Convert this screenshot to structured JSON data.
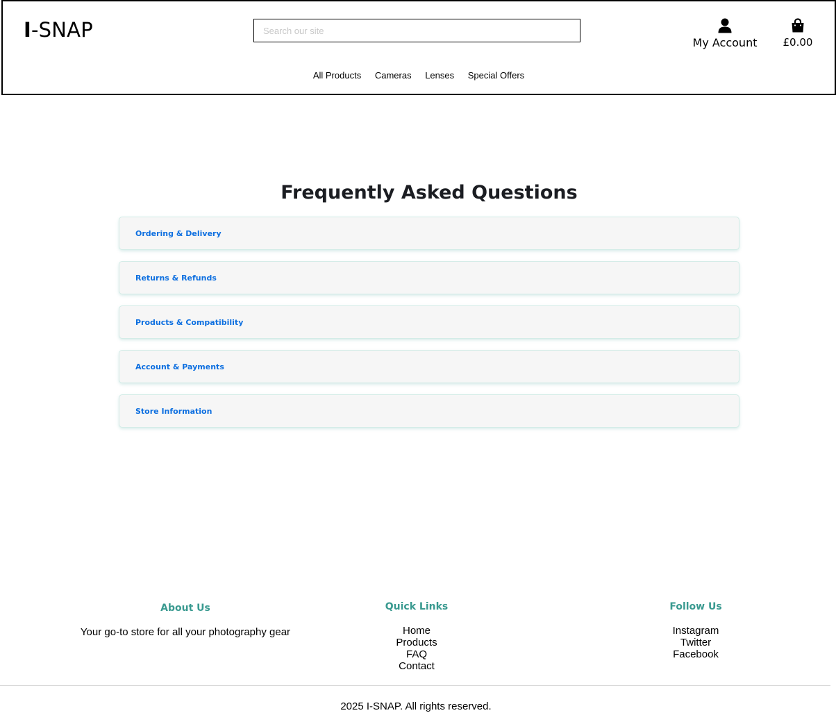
{
  "header": {
    "logo_bar": "I",
    "logo_text": "-SNAP",
    "search_placeholder": "Search our site",
    "account_label": "My Account",
    "cart_total": "£0.00",
    "account_icon": "user-icon",
    "cart_icon": "shopping-bag-icon"
  },
  "nav": {
    "items": [
      "All Products",
      "Cameras",
      "Lenses",
      "Special Offers"
    ]
  },
  "faq": {
    "title": "Frequently Asked Questions",
    "sections": [
      "Ordering & Delivery",
      "Returns & Refunds",
      "Products & Compatibility",
      "Account & Payments",
      "Store Information"
    ]
  },
  "footer": {
    "about": {
      "heading": "About Us",
      "text": "Your go-to store for all your photography gear"
    },
    "quick_links": {
      "heading": "Quick Links",
      "links": [
        "Home",
        "Products",
        "FAQ",
        "Contact"
      ]
    },
    "follow": {
      "heading": "Follow Us",
      "links": [
        "Instagram",
        "Twitter",
        "Facebook"
      ]
    },
    "copyright": "2025 I-SNAP. All rights reserved."
  },
  "colors": {
    "accent_link": "#0d6fe0",
    "footer_heading": "#3a9a90",
    "faq_background": "#f6f6f6"
  }
}
